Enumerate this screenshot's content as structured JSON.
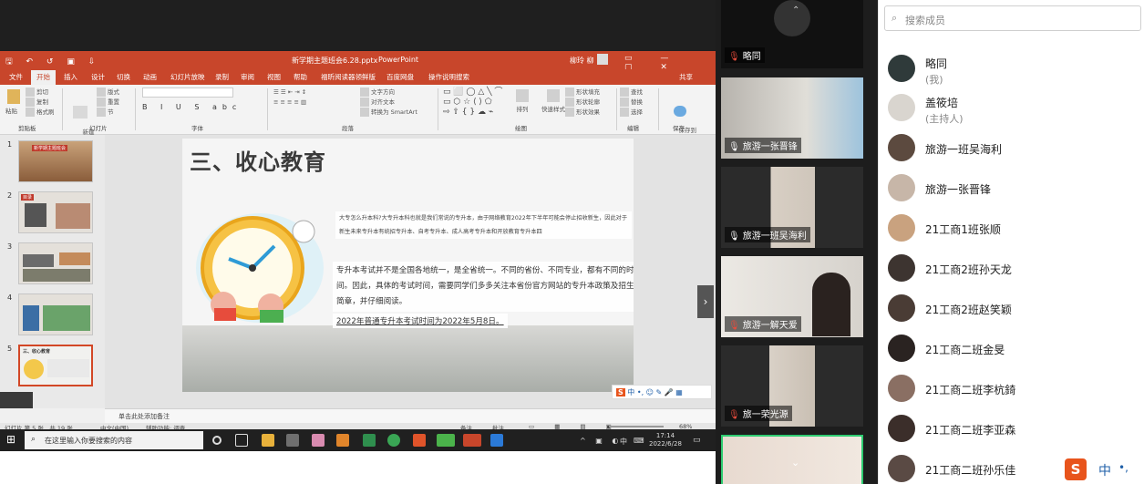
{
  "ppt": {
    "quick_access": "🖫 ↶ ↺ ▣ ⇩",
    "doc_title": "新学期主题班会6.28.pptx",
    "app_name": "PowerPoint",
    "user": "柳玲 柳",
    "tabs": [
      "文件",
      "开始",
      "插入",
      "设计",
      "切换",
      "动画",
      "幻灯片放映",
      "录制",
      "审阅",
      "视图",
      "帮助",
      "福昕阅读器领鲜版",
      "百度网盘",
      "操作说明搜索",
      "共享"
    ],
    "active_tab_index": 1,
    "ribbon_groups": [
      "剪贴板",
      "幻灯片",
      "字体",
      "段落",
      "绘图",
      "编辑",
      "保存"
    ],
    "ribbon_buttons": {
      "paste": "粘贴",
      "new_slide": "新建\n幻灯片",
      "layout": "版式",
      "reset": "重置",
      "section": "节",
      "text_direction": "文字方向",
      "align_text": "对齐文本",
      "smartart": "转换为 SmartArt",
      "arrange": "排列",
      "quick_styles": "快速样式",
      "shape_fill": "形状填充",
      "shape_outline": "形状轮廓",
      "shape_effects": "形状效果",
      "find": "查找",
      "replace": "替换",
      "select": "选择",
      "save_to_baidu": "保存到\n百度网盘"
    },
    "thumbnails": [
      {
        "num": "1",
        "label": "新学期主题班会"
      },
      {
        "num": "2",
        "label": "目录"
      },
      {
        "num": "3",
        "label": ""
      },
      {
        "num": "4",
        "label": ""
      },
      {
        "num": "5",
        "label": "三、收心教育"
      }
    ],
    "selected_thumb_index": 4,
    "slide": {
      "title": "三、收心教育",
      "para1": "大专怎么升本科?大专升本科也就是我们常说的专升本，由于网络教育2022年下半年可能会停止招收新生，因此对于新生未来专升本有统招专升本、自考专升本、成人高考专升本和开放教育专升本四",
      "para2": "专升本考试并不是全国各地统一，是全省统一。不同的省份、不同专业，都有不同的时间。因此，具体的考试时间，需要同学们多多关注本省份官方网站的专升本政策及招生简章，并仔细阅读。",
      "para3": "2022年普通专升本考试时间为2022年5月8日。"
    },
    "notes_placeholder": "单击此处添加备注",
    "status": {
      "slide_info": "幻灯片 第 5 张，共 19 张",
      "language": "中文(中国)",
      "accessibility": "辅助功能: 调查",
      "notes_btn": "备注",
      "comments_btn": "批注",
      "zoom": "68%"
    }
  },
  "taskbar": {
    "search_placeholder": "在这里输入你要搜索的内容",
    "time": "17:14",
    "date": "2022/6/28",
    "ime": "中"
  },
  "videos": [
    {
      "name": "略同",
      "mic_muted": true
    },
    {
      "name": "旅游一张晋锋",
      "mic_muted": false
    },
    {
      "name": "旅游一班吴海利",
      "mic_muted": false
    },
    {
      "name": "旅游一解天爱",
      "mic_muted": true
    },
    {
      "name": "旅一荣光源",
      "mic_muted": true
    },
    {
      "name": "",
      "mic_muted": false
    }
  ],
  "members": {
    "search_placeholder": "搜索成员",
    "list": [
      {
        "name": "略同",
        "sub": "(我)"
      },
      {
        "name": "盖筱培",
        "sub": "(主持人)"
      },
      {
        "name": "旅游一班吴海利",
        "sub": ""
      },
      {
        "name": "旅游一张晋锋",
        "sub": ""
      },
      {
        "name": "21工商1班张顺",
        "sub": ""
      },
      {
        "name": "21工商2班孙天龙",
        "sub": ""
      },
      {
        "name": "21工商2班赵笑颖",
        "sub": ""
      },
      {
        "name": "21工商二班金旻",
        "sub": ""
      },
      {
        "name": "21工商二班李杭錡",
        "sub": ""
      },
      {
        "name": "21工商二班李亚森",
        "sub": ""
      },
      {
        "name": "21工商二班孙乐佳",
        "sub": ""
      }
    ]
  },
  "ime_bar": {
    "logo": "S",
    "mode": "中",
    "punct": "•,"
  }
}
